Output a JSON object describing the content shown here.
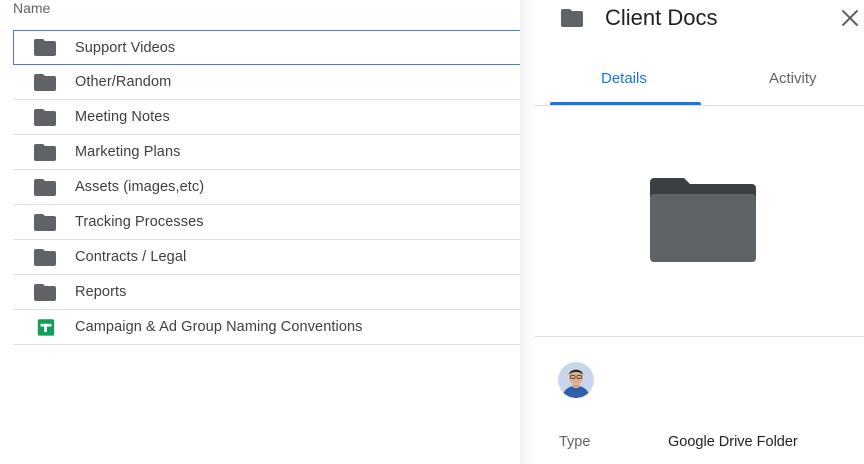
{
  "list": {
    "column_header": "Name",
    "items": [
      {
        "label": "Support Videos",
        "icon": "folder-icon",
        "selected": true
      },
      {
        "label": "Other/Random",
        "icon": "folder-icon"
      },
      {
        "label": "Meeting Notes",
        "icon": "folder-icon"
      },
      {
        "label": "Marketing Plans",
        "icon": "folder-icon"
      },
      {
        "label": "Assets (images,etc)",
        "icon": "folder-icon"
      },
      {
        "label": "Tracking Processes",
        "icon": "folder-icon"
      },
      {
        "label": "Contracts / Legal",
        "icon": "folder-icon"
      },
      {
        "label": "Reports",
        "icon": "folder-icon"
      },
      {
        "label": "Campaign & Ad Group Naming Conventions",
        "icon": "google-sheets-icon"
      }
    ]
  },
  "details": {
    "title": "Client Docs",
    "title_icon": "folder-icon",
    "close_icon": "close-icon",
    "tabs": [
      {
        "label": "Details",
        "active": true
      },
      {
        "label": "Activity",
        "active": false
      }
    ],
    "preview_icon": "folder-icon",
    "owner_avatar": "avatar",
    "properties": [
      {
        "key": "Type",
        "value": "Google Drive Folder"
      }
    ]
  },
  "colors": {
    "accent": "#1a73e8",
    "selection_border": "#4a7cc9",
    "folder": "#5f6368",
    "sheets": "#0f9d58"
  }
}
